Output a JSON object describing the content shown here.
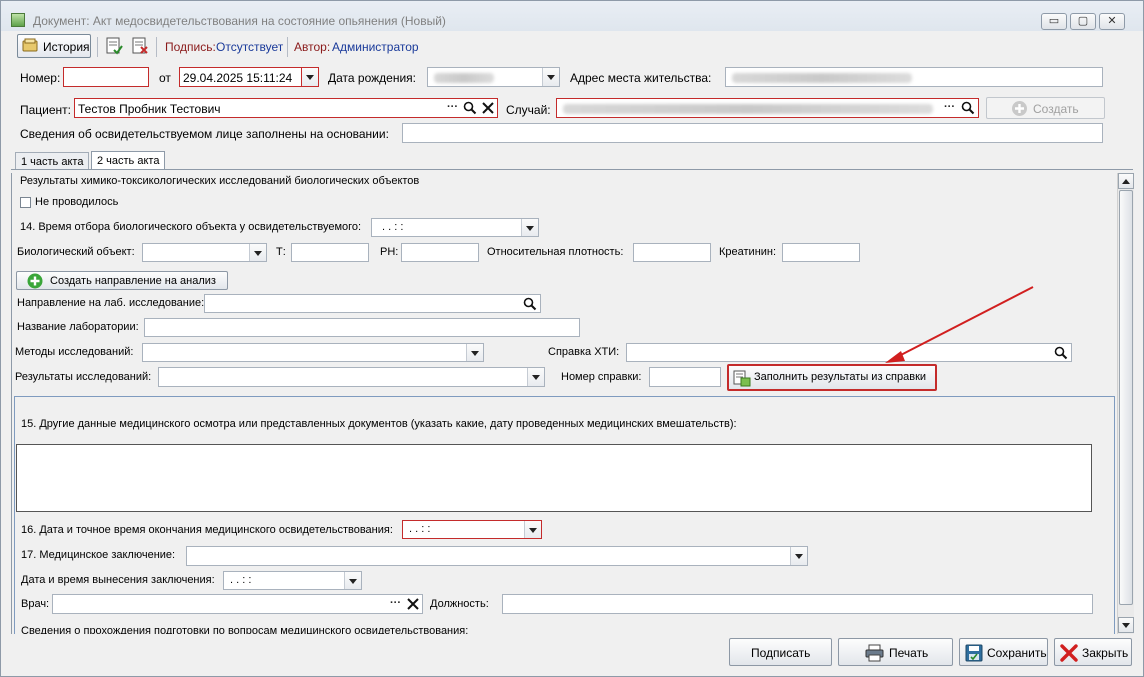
{
  "window": {
    "title": "Документ: Акт медосвидетельствования на состояние опьянения (Новый)",
    "minimize": "▭",
    "restore": "▢",
    "close": "✕"
  },
  "toolbar": {
    "history_label": "История",
    "signature_label": "Подпись:",
    "signature_value": "Отсутствует",
    "author_label": "Автор:",
    "author_value": "Администратор"
  },
  "header": {
    "number_label": "Номер:",
    "number_value": "",
    "from_label": "от",
    "date_value": "29.04.2025 15:11:24",
    "birth_label": "Дата рождения:",
    "address_label": "Адрес места жительства:",
    "patient_label": "Пациент:",
    "patient_value": "Тестов Пробник Тестович",
    "case_label": "Случай:",
    "create_label": "Создать",
    "basis_label": "Сведения об освидетельствуемом лице заполнены на основании:"
  },
  "tabs": [
    {
      "label": "1 часть акта",
      "active": false
    },
    {
      "label": "2 часть акта",
      "active": true
    }
  ],
  "part2": {
    "section_title": "Результаты химико-токсикологических исследований биологических объектов",
    "not_done_label": "Не проводилось",
    "not_done_checked": false,
    "q14_label": "14. Время отбора биологического объекта у освидетельствуемого:",
    "q14_value": ".  .      :  :",
    "bio_object_label": "Биологический объект:",
    "t_label": "Т:",
    "ph_label": "РН:",
    "density_label": "Относительная плотность:",
    "creatinine_label": "Креатинин:",
    "create_referral_label": "Создать направление на анализ",
    "referral_label": "Направление на лаб. исследование:",
    "lab_name_label": "Название лаборатории:",
    "methods_label": "Методы исследований:",
    "hti_label": "Справка ХТИ:",
    "results_label": "Результаты исследований:",
    "cert_number_label": "Номер справки:",
    "fill_from_cert_label": "Заполнить результаты из справки",
    "q15_label": "15. Другие данные медицинского осмотра или представленных документов (указать какие, дату проведенных медицинских вмешательств):",
    "q16_label": "16. Дата и точное время окончания медицинского освидетельствования:",
    "q16_value": ".  .      :  :",
    "q17_label": "17. Медицинское заключение:",
    "conclusion_datetime_label": "Дата и время вынесения заключения:",
    "conclusion_datetime_value": ".  .      :  :",
    "doctor_label": "Врач:",
    "position_label": "Должность:",
    "training_label": "Сведения о прохождения подготовки по вопросам медицинского освидетельствования:"
  },
  "footer": {
    "sign_label": "Подписать",
    "print_label": "Печать",
    "save_label": "Сохранить",
    "close_label": "Закрыть"
  },
  "colors": {
    "required_border": "#c42b2b",
    "annotation_arrow": "#d11f1f",
    "toolbar_value": "#1a3a9a"
  }
}
